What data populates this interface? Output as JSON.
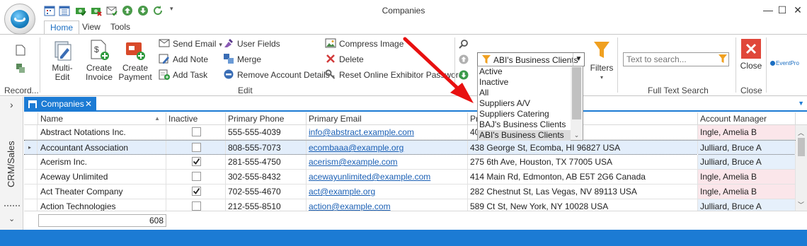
{
  "window": {
    "title": "Companies",
    "minimize": "—",
    "maximize": "☐",
    "close": "✕"
  },
  "ribbon_tabs": [
    "Home",
    "View",
    "Tools"
  ],
  "ribbon": {
    "record_label": "Record...",
    "multi_edit": "Multi-Edit",
    "create_invoice_1": "Create",
    "create_invoice_2": "Invoice",
    "create_payment_1": "Create",
    "create_payment_2": "Payment",
    "send_email": "Send Email",
    "add_note": "Add Note",
    "add_task": "Add Task",
    "user_fields": "User Fields",
    "merge": "Merge",
    "remove_account_details": "Remove Account Details",
    "compress_image": "Compress Image",
    "delete": "Delete",
    "reset_password": "Reset Online Exhibitor Password",
    "edit_group": "Edit",
    "filters": "Filters",
    "full_text_search": "Full Text Search",
    "close_label": "Close",
    "close_group": "Close",
    "eventpro": "EventPro"
  },
  "filter": {
    "selected": "ABI's Business Clients",
    "options": [
      "Active",
      "Inactive",
      "All",
      "Suppliers A/V",
      "Suppliers Catering",
      "BAJ's Business Clients",
      "ABI's Business Clients"
    ],
    "highlighted_index": 6
  },
  "search": {
    "placeholder": "Text to search..."
  },
  "side_panel": {
    "label": "CRM/Sales"
  },
  "doc_tab": {
    "label": "Companies",
    "close": "✕"
  },
  "grid": {
    "columns": [
      "Name",
      "Inactive",
      "Primary Phone",
      "Primary Email",
      "Pri",
      "Account Manager"
    ],
    "rows": [
      {
        "name": "Abstract Notations Inc.",
        "inactive": false,
        "phone": "555-555-4039",
        "email": "info@abstract.example.com",
        "address": "40",
        "manager": "Ingle, Amelia B",
        "mgr_color": "pink",
        "focused": false
      },
      {
        "name": "Accountant Association",
        "inactive": false,
        "phone": "808-555-7073",
        "email": "ecombaaa@example.org",
        "address": "438 George St, Ecomba, HI 96827 USA",
        "manager": "Julliard, Bruce A",
        "mgr_color": "none",
        "focused": true
      },
      {
        "name": "Acerism Inc.",
        "inactive": true,
        "phone": "281-555-4750",
        "email": "acerism@example.com",
        "address": "275 6th Ave, Houston, TX 77005 USA",
        "manager": "Julliard, Bruce A",
        "mgr_color": "blue",
        "focused": false
      },
      {
        "name": "Aceway Unlimited",
        "inactive": false,
        "phone": "302-555-8432",
        "email": "acewayunlimited@example.com",
        "address": "414 Main Rd, Edmonton, AB E5T 2G6 Canada",
        "manager": "Ingle, Amelia B",
        "mgr_color": "pink",
        "focused": false
      },
      {
        "name": "Act Theater Company",
        "inactive": true,
        "phone": "702-555-4670",
        "email": "act@example.org",
        "address": "282 Chestnut St, Las Vegas, NV 89113 USA",
        "manager": "Ingle, Amelia B",
        "mgr_color": "pink",
        "focused": false
      },
      {
        "name": "Action Technologies",
        "inactive": false,
        "phone": "212-555-8510",
        "email": "action@example.com",
        "address": "589 Ct St, New York, NY 10028 USA",
        "manager": "Julliard, Bruce A",
        "mgr_color": "blue",
        "focused": false
      }
    ],
    "footer_count": "608"
  },
  "colors": {
    "accent": "#1c7bd4",
    "arrow": "#e81010",
    "mgr_pink": "#fbe6ea",
    "mgr_blue": "#e6f0fb"
  }
}
